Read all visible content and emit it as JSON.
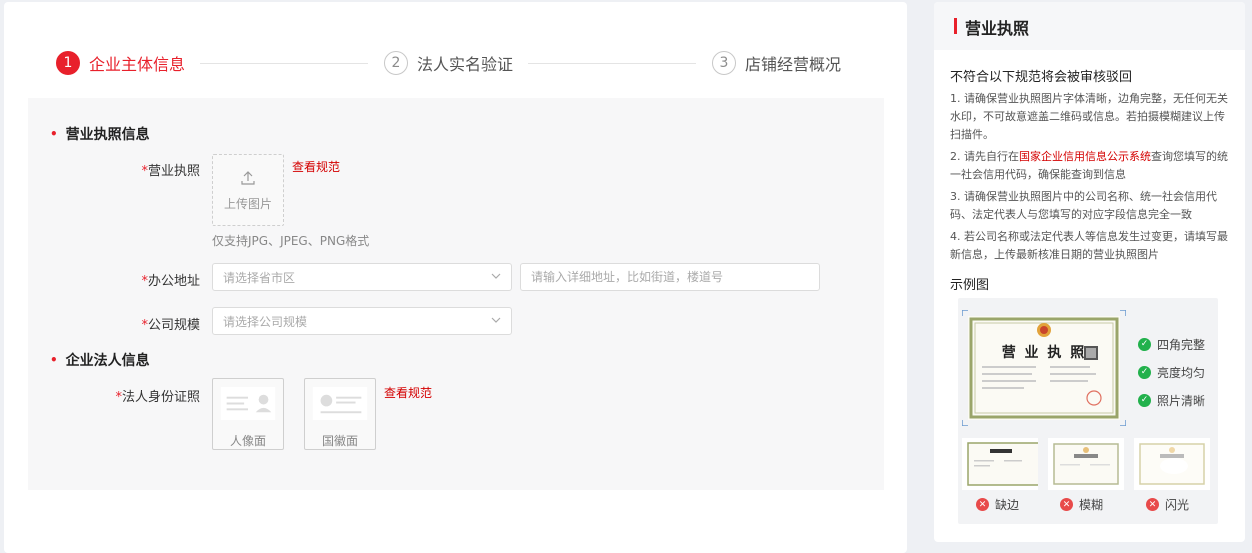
{
  "steps": [
    {
      "num": "1",
      "label": "企业主体信息"
    },
    {
      "num": "2",
      "label": "法人实名验证"
    },
    {
      "num": "3",
      "label": "店铺经营概况"
    }
  ],
  "form": {
    "section_license": "营业执照信息",
    "license_label": "营业执照",
    "required_mark": "*",
    "upload_text": "上传图片",
    "view_rules_link": "查看规范",
    "upload_hint": "仅支持JPG、JPEG、PNG格式",
    "office_label": "办公地址",
    "region_placeholder": "请选择省市区",
    "address_placeholder": "请输入详细地址，比如街道，楼道号",
    "scale_label": "公司规模",
    "scale_placeholder": "请选择公司规模",
    "section_legal": "企业法人信息",
    "id_label": "法人身份证照",
    "id_front": "人像面",
    "id_back": "国徽面",
    "view_rules_link_2": "查看规范"
  },
  "side": {
    "title": "营业执照",
    "subtitle": "不符合以下规范将会被审核驳回",
    "rules": [
      {
        "before": "1. 请确保营业执照图片字体清晰，边角完整，无任何无关水印，不可故意遮盖二维码或信息。若拍摄模糊建议上传扫描件。",
        "highlight": "",
        "after": ""
      },
      {
        "before": "2. 请先自行在",
        "highlight": "国家企业信用信息公示系统",
        "after": "查询您填写的统一社会信用代码，确保能查询到信息"
      },
      {
        "before": "3. 请确保营业执照图片中的公司名称、统一社会信用代码、法定代表人与您填写的对应字段信息完全一致",
        "highlight": "",
        "after": ""
      },
      {
        "before": "4. 若公司名称或法定代表人等信息发生过变更，请填写最新信息，上传最新核准日期的营业执照图片",
        "highlight": "",
        "after": ""
      }
    ],
    "example_title": "示例图",
    "sample_caption": "营 业 执 照",
    "checks": [
      "四角完整",
      "亮度均匀",
      "照片清晰"
    ],
    "bad_examples": [
      "缺边",
      "模糊",
      "闪光"
    ]
  },
  "colors": {
    "accent": "#e8202b",
    "link": "#d40000",
    "ok": "#22b14c",
    "bad": "#e84a4a"
  }
}
